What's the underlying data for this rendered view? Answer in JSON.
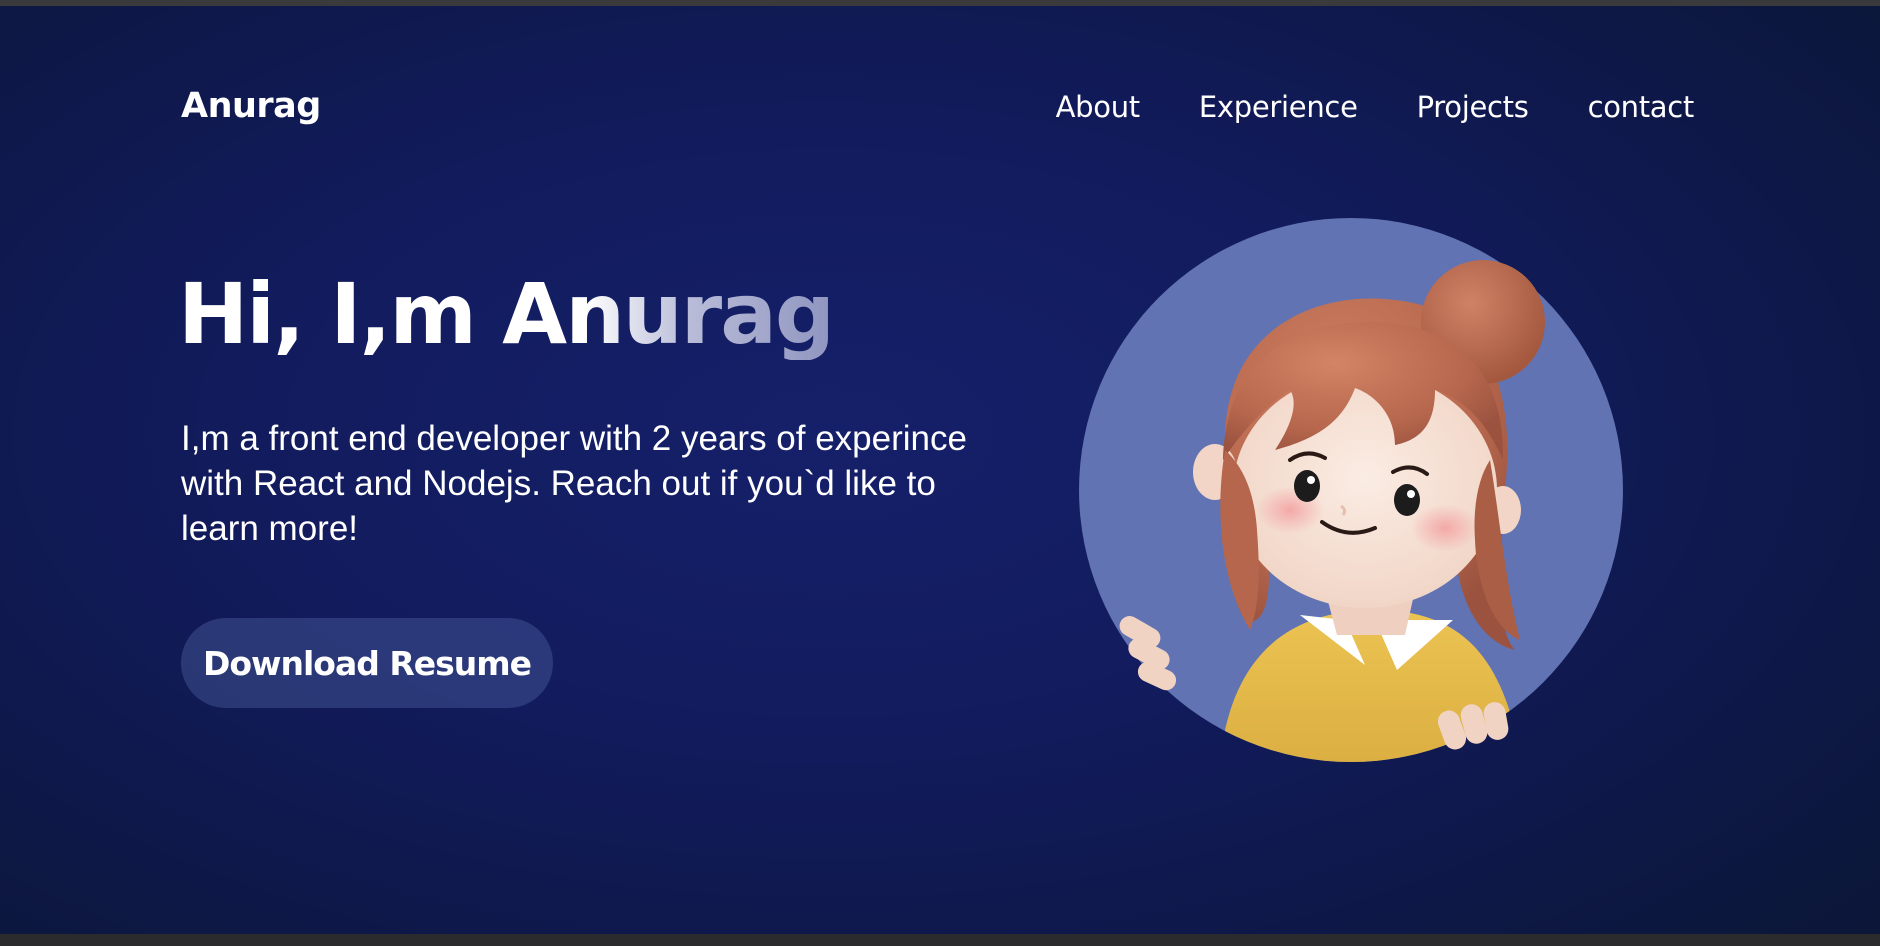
{
  "header": {
    "brand": "Anurag",
    "nav": [
      {
        "label": "About"
      },
      {
        "label": "Experience"
      },
      {
        "label": "Projects"
      },
      {
        "label": "contact"
      }
    ]
  },
  "hero": {
    "title": "Hi, I,m Anurag",
    "description": "I,m a front end developer with 2 years of experince with React and Nodejs. Reach out if you`d like to learn more!",
    "button_label": "Download Resume"
  },
  "colors": {
    "background": "#121b5c",
    "avatar_circle": "#6173b2",
    "hair": "#bb6e55",
    "shirt": "#e6ba4a"
  },
  "icons": {
    "avatar": "cartoon-girl-avatar"
  }
}
